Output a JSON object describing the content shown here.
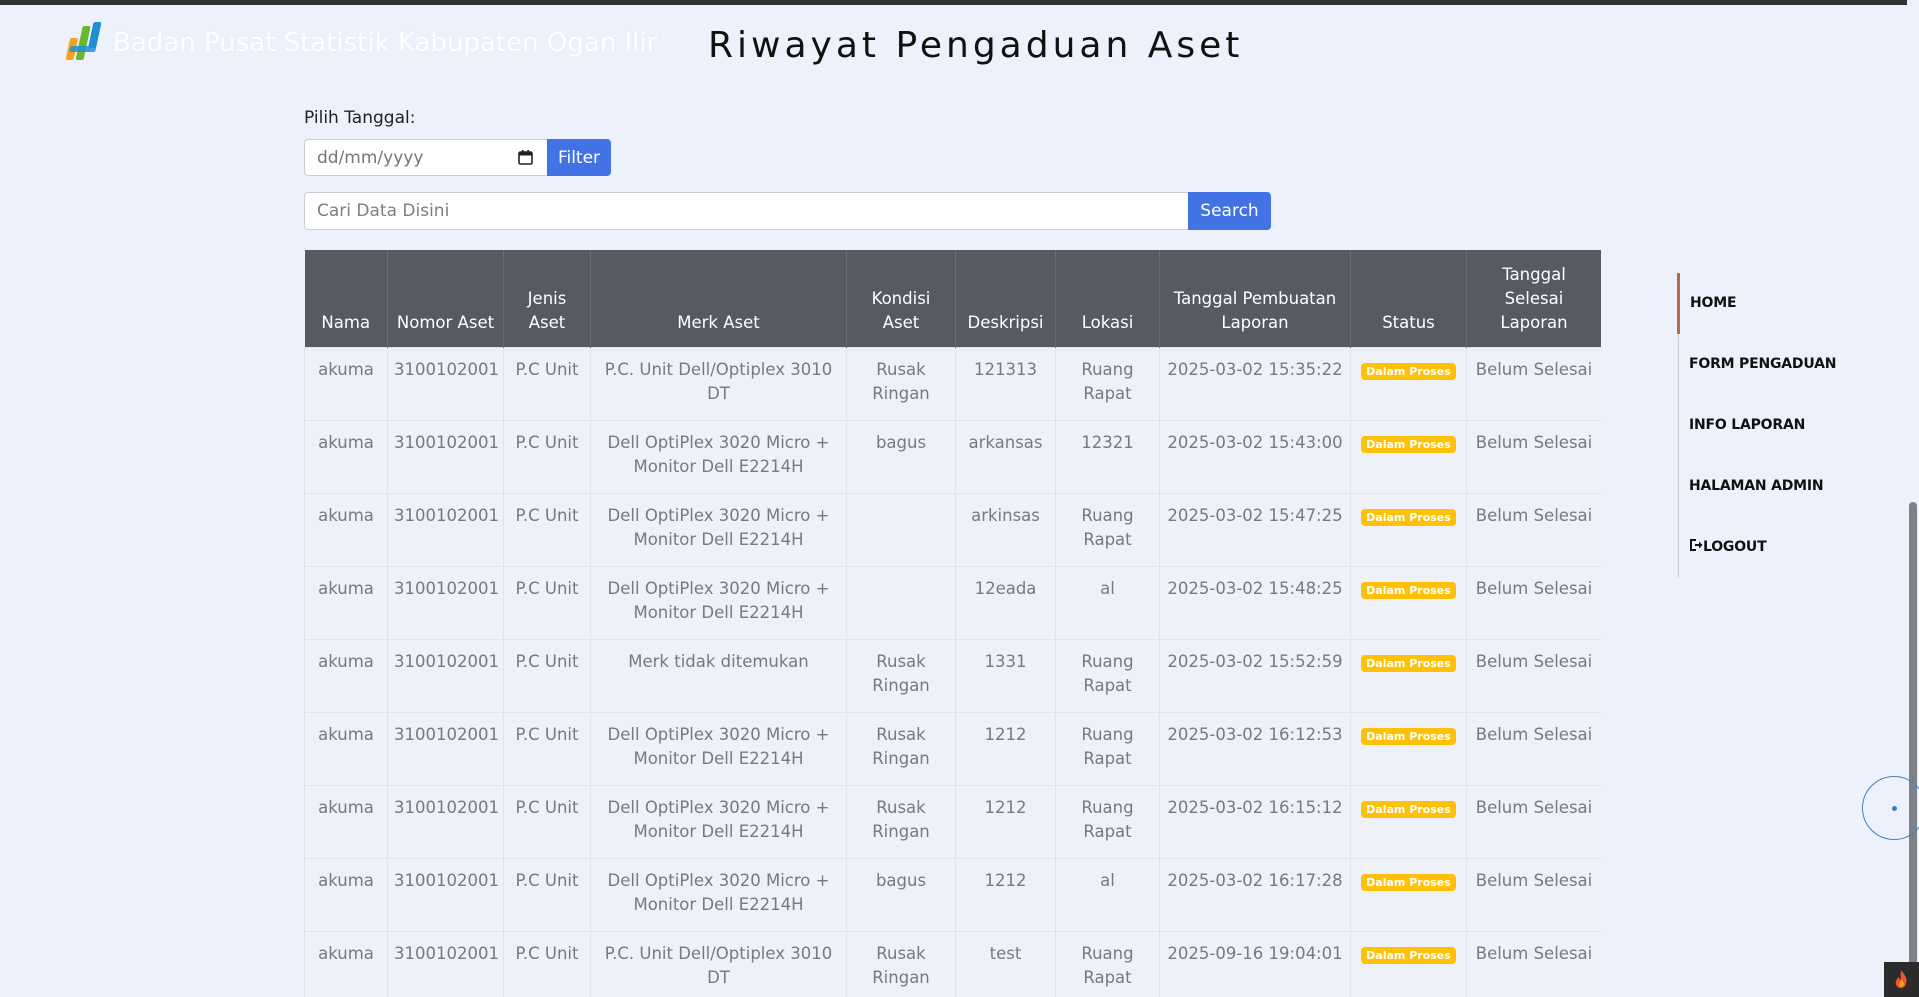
{
  "header": {
    "brand_text": "Badan Pusat Statistik Kabupaten Ogan Ilir",
    "page_title": "Riwayat Pengaduan Aset"
  },
  "filter": {
    "label": "Pilih Tanggal:",
    "date_placeholder": "dd/mm/yyyy",
    "button_label": "Filter"
  },
  "search": {
    "placeholder": "Cari Data Disini",
    "button_label": "Search"
  },
  "table": {
    "columns": [
      "Nama",
      "Nomor Aset",
      "Jenis Aset",
      "Merk Aset",
      "Kondisi Aset",
      "Deskripsi",
      "Lokasi",
      "Tanggal Pembuatan Laporan",
      "Status",
      "Tanggal Selesai Laporan"
    ],
    "rows": [
      {
        "nama": "akuma",
        "nomor": "3100102001",
        "jenis": "P.C Unit",
        "merk": "P.C. Unit Dell/Optiplex 3010 DT",
        "kondisi": "Rusak Ringan",
        "deskripsi": "121313",
        "lokasi": "Ruang Rapat",
        "tanggal": "2025-03-02 15:35:22",
        "status": "Dalam Proses",
        "selesai": "Belum Selesai"
      },
      {
        "nama": "akuma",
        "nomor": "3100102001",
        "jenis": "P.C Unit",
        "merk": "Dell OptiPlex 3020 Micro + Monitor Dell E2214H",
        "kondisi": "bagus",
        "deskripsi": "arkansas",
        "lokasi": "12321",
        "tanggal": "2025-03-02 15:43:00",
        "status": "Dalam Proses",
        "selesai": "Belum Selesai"
      },
      {
        "nama": "akuma",
        "nomor": "3100102001",
        "jenis": "P.C Unit",
        "merk": "Dell OptiPlex 3020 Micro + Monitor Dell E2214H",
        "kondisi": "",
        "deskripsi": "arkinsas",
        "lokasi": "Ruang Rapat",
        "tanggal": "2025-03-02 15:47:25",
        "status": "Dalam Proses",
        "selesai": "Belum Selesai"
      },
      {
        "nama": "akuma",
        "nomor": "3100102001",
        "jenis": "P.C Unit",
        "merk": "Dell OptiPlex 3020 Micro + Monitor Dell E2214H",
        "kondisi": "",
        "deskripsi": "12eada",
        "lokasi": "al",
        "tanggal": "2025-03-02 15:48:25",
        "status": "Dalam Proses",
        "selesai": "Belum Selesai"
      },
      {
        "nama": "akuma",
        "nomor": "3100102001",
        "jenis": "P.C Unit",
        "merk": "Merk tidak ditemukan",
        "kondisi": "Rusak Ringan",
        "deskripsi": "1331",
        "lokasi": "Ruang Rapat",
        "tanggal": "2025-03-02 15:52:59",
        "status": "Dalam Proses",
        "selesai": "Belum Selesai"
      },
      {
        "nama": "akuma",
        "nomor": "3100102001",
        "jenis": "P.C Unit",
        "merk": "Dell OptiPlex 3020 Micro + Monitor Dell E2214H",
        "kondisi": "Rusak Ringan",
        "deskripsi": "1212",
        "lokasi": "Ruang Rapat",
        "tanggal": "2025-03-02 16:12:53",
        "status": "Dalam Proses",
        "selesai": "Belum Selesai"
      },
      {
        "nama": "akuma",
        "nomor": "3100102001",
        "jenis": "P.C Unit",
        "merk": "Dell OptiPlex 3020 Micro + Monitor Dell E2214H",
        "kondisi": "Rusak Ringan",
        "deskripsi": "1212",
        "lokasi": "Ruang Rapat",
        "tanggal": "2025-03-02 16:15:12",
        "status": "Dalam Proses",
        "selesai": "Belum Selesai"
      },
      {
        "nama": "akuma",
        "nomor": "3100102001",
        "jenis": "P.C Unit",
        "merk": "Dell OptiPlex 3020 Micro + Monitor Dell E2214H",
        "kondisi": "bagus",
        "deskripsi": "1212",
        "lokasi": "al",
        "tanggal": "2025-03-02 16:17:28",
        "status": "Dalam Proses",
        "selesai": "Belum Selesai"
      },
      {
        "nama": "akuma",
        "nomor": "3100102001",
        "jenis": "P.C Unit",
        "merk": "P.C. Unit Dell/Optiplex 3010 DT",
        "kondisi": "Rusak Ringan",
        "deskripsi": "test",
        "lokasi": "Ruang Rapat",
        "tanggal": "2025-09-16 19:04:01",
        "status": "Dalam Proses",
        "selesai": "Belum Selesai"
      }
    ]
  },
  "sidebar": {
    "items": [
      {
        "label": "HOME",
        "active": true
      },
      {
        "label": "FORM PENGADUAN",
        "active": false
      },
      {
        "label": "INFO LAPORAN",
        "active": false
      },
      {
        "label": "HALAMAN ADMIN",
        "active": false
      },
      {
        "label": "LOGOUT",
        "active": false,
        "icon": "logout-icon"
      }
    ]
  },
  "colors": {
    "accent": "#4372e5",
    "table_header": "#575a63",
    "badge": "#ffc107",
    "active_nav_border": "#c0654d"
  }
}
